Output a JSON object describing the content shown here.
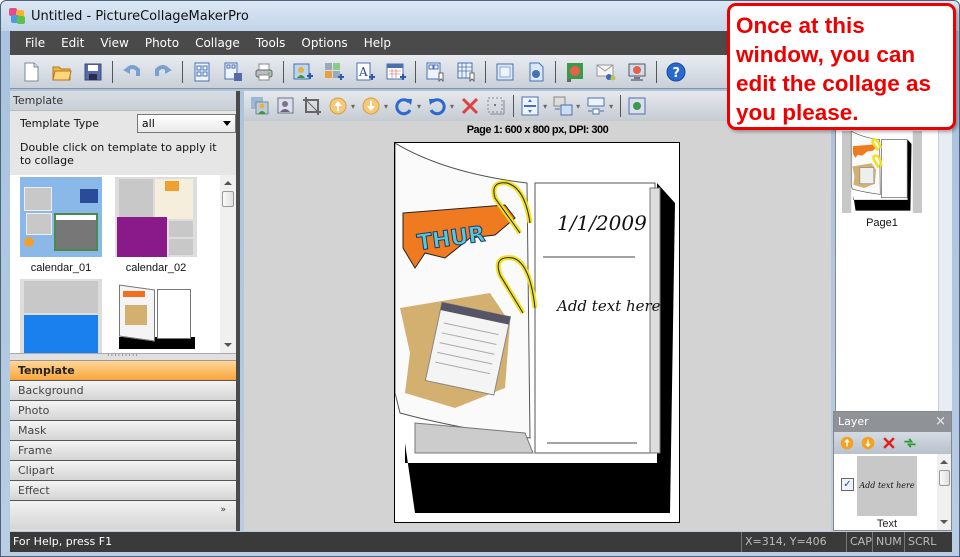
{
  "window": {
    "title": "Untitled - PictureCollageMakerPro"
  },
  "menu": [
    "File",
    "Edit",
    "View",
    "Photo",
    "Collage",
    "Tools",
    "Options",
    "Help"
  ],
  "toolbar_main": {
    "icons": [
      "new-file-icon",
      "open-folder-icon",
      "save-icon",
      "undo-icon",
      "redo-icon",
      "template-grid-icon",
      "save-template-icon",
      "print-icon",
      "add-photo-icon",
      "add-clipart-icon",
      "add-text-icon",
      "add-calendar-icon",
      "page-setup-icon",
      "grid-setup-icon",
      "fit-page-icon",
      "export-icon",
      "set-wallpaper-icon",
      "email-icon",
      "screensaver-icon",
      "help-icon"
    ]
  },
  "toolbar_edit": {
    "icons": [
      "replace-photo-icon",
      "edit-photo-icon",
      "crop-icon",
      "bring-forward-icon",
      "send-backward-icon",
      "rotate-right-icon",
      "rotate-left-icon",
      "delete-icon",
      "select-all-icon",
      "align-center-icon",
      "align-left-icon",
      "distribute-icon",
      "preview-icon"
    ]
  },
  "left_panel": {
    "header": "Template",
    "template_type_label": "Template Type",
    "template_type_value": "all",
    "hint": "Double click on template to apply it to collage",
    "templates": [
      {
        "name": "calendar_01"
      },
      {
        "name": "calendar_02"
      },
      {
        "name": ""
      },
      {
        "name": ""
      }
    ],
    "categories": [
      {
        "label": "Template",
        "active": true
      },
      {
        "label": "Background",
        "active": false
      },
      {
        "label": "Photo",
        "active": false
      },
      {
        "label": "Mask",
        "active": false
      },
      {
        "label": "Frame",
        "active": false
      },
      {
        "label": "Clipart",
        "active": false
      },
      {
        "label": "Effect",
        "active": false
      }
    ],
    "more_label": "»"
  },
  "canvas": {
    "page_info": "Page 1: 600 x 800 px, DPI: 300",
    "date_text": "1/1/2009",
    "day_text": "THUR",
    "placeholder_text": "Add text here"
  },
  "pages_panel": {
    "pages": [
      {
        "label": "Page1"
      }
    ]
  },
  "layer_panel": {
    "title": "Layer",
    "close": "×",
    "layers": [
      {
        "name": "Text",
        "preview": "Add text here",
        "checked": true
      }
    ]
  },
  "statusbar": {
    "help": "For Help, press F1",
    "coords": "X=314, Y=406",
    "cap": "CAP",
    "num": "NUM",
    "scrl": "SCRL"
  },
  "callout": {
    "text": "Once at this window, you can edit the collage as you please."
  },
  "colors": {
    "accent_active": "#f8a53a",
    "callout": "#e00000",
    "menubar": "#4a4a4a"
  }
}
